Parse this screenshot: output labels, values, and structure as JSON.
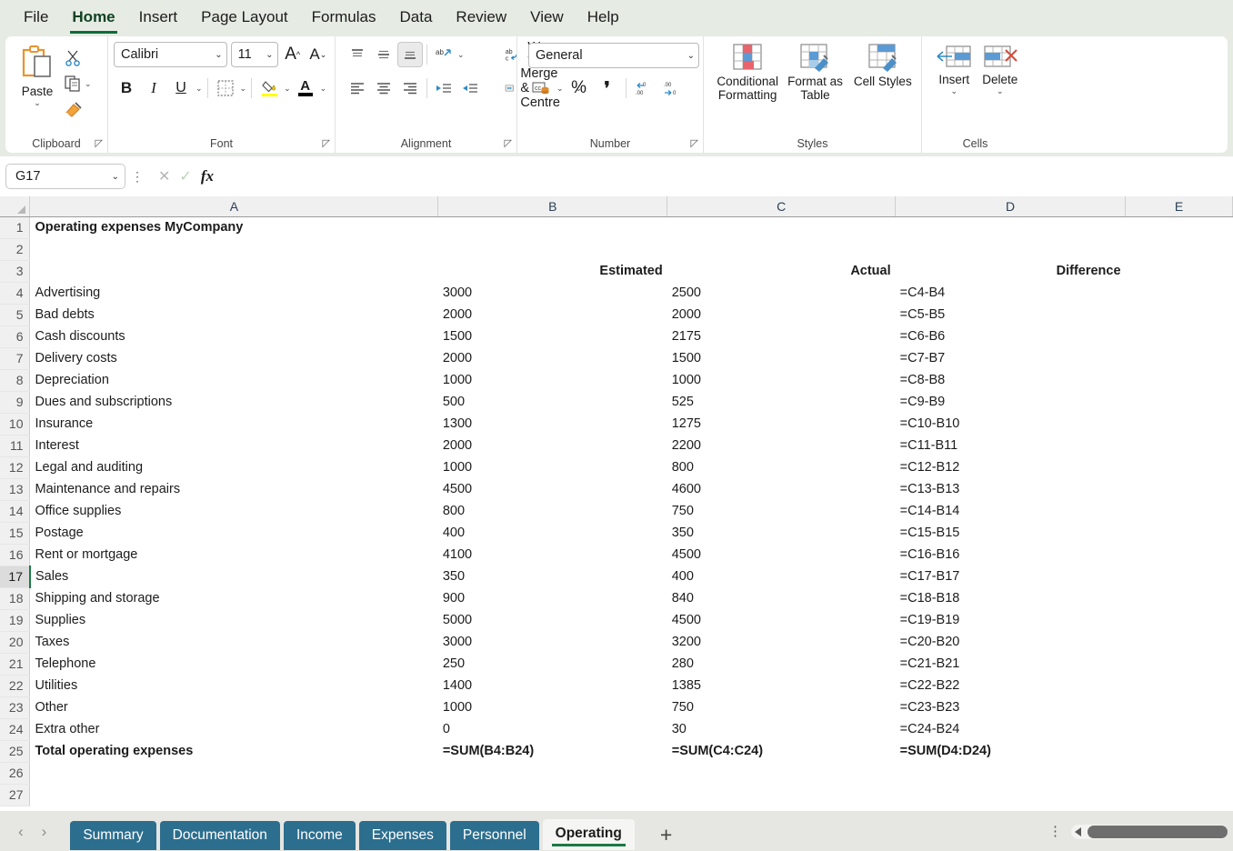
{
  "ribbon": {
    "tabs": [
      {
        "label": "File",
        "active": false
      },
      {
        "label": "Home",
        "active": true
      },
      {
        "label": "Insert",
        "active": false
      },
      {
        "label": "Page Layout",
        "active": false
      },
      {
        "label": "Formulas",
        "active": false
      },
      {
        "label": "Data",
        "active": false
      },
      {
        "label": "Review",
        "active": false
      },
      {
        "label": "View",
        "active": false
      },
      {
        "label": "Help",
        "active": false
      }
    ],
    "groups": {
      "clipboard": {
        "label": "Clipboard",
        "paste": "Paste",
        "cut_icon": "scissors-icon",
        "copy_icon": "copy-icon",
        "format_painter_icon": "format-painter-icon"
      },
      "font": {
        "label": "Font",
        "font_name": "Calibri",
        "font_size": "11",
        "grow_font": "A",
        "shrink_font": "A",
        "bold": "B",
        "italic": "I",
        "underline": "U"
      },
      "alignment": {
        "label": "Alignment",
        "wrap_text": "Wrap Text",
        "merge_centre": "Merge & Centre"
      },
      "number": {
        "label": "Number",
        "format": "General",
        "percent": "%",
        "comma": "‰"
      },
      "styles": {
        "label": "Styles",
        "conditional_formatting": "Conditional Formatting",
        "format_as_table": "Format as Table",
        "cell_styles": "Cell Styles"
      },
      "cells": {
        "label": "Cells",
        "insert": "Insert",
        "delete": "Delete"
      }
    }
  },
  "formula_bar": {
    "name_box": "G17",
    "formula_value": "",
    "cancel_icon": "close-icon",
    "enter_icon": "check-icon",
    "function_icon": "fx-icon"
  },
  "grid": {
    "columns": [
      "A",
      "B",
      "C",
      "D",
      "E"
    ],
    "selected_row": 17,
    "title": "Operating expenses MyCompany",
    "headers": {
      "a": "",
      "b": "Estimated",
      "c": "Actual",
      "d": "Difference"
    },
    "rows": [
      {
        "n": 4,
        "label": "Advertising",
        "estimated": "3000",
        "actual": "2500",
        "difference": "=C4-B4"
      },
      {
        "n": 5,
        "label": "Bad debts",
        "estimated": "2000",
        "actual": "2000",
        "difference": "=C5-B5"
      },
      {
        "n": 6,
        "label": "Cash discounts",
        "estimated": "1500",
        "actual": "2175",
        "difference": "=C6-B6"
      },
      {
        "n": 7,
        "label": "Delivery costs",
        "estimated": "2000",
        "actual": "1500",
        "difference": "=C7-B7"
      },
      {
        "n": 8,
        "label": "Depreciation",
        "estimated": "1000",
        "actual": "1000",
        "difference": "=C8-B8"
      },
      {
        "n": 9,
        "label": "Dues and subscriptions",
        "estimated": "500",
        "actual": "525",
        "difference": "=C9-B9"
      },
      {
        "n": 10,
        "label": "Insurance",
        "estimated": "1300",
        "actual": "1275",
        "difference": "=C10-B10"
      },
      {
        "n": 11,
        "label": "Interest",
        "estimated": "2000",
        "actual": "2200",
        "difference": "=C11-B11"
      },
      {
        "n": 12,
        "label": "Legal and auditing",
        "estimated": "1000",
        "actual": "800",
        "difference": "=C12-B12"
      },
      {
        "n": 13,
        "label": "Maintenance and repairs",
        "estimated": "4500",
        "actual": "4600",
        "difference": "=C13-B13"
      },
      {
        "n": 14,
        "label": "Office supplies",
        "estimated": "800",
        "actual": "750",
        "difference": "=C14-B14"
      },
      {
        "n": 15,
        "label": "Postage",
        "estimated": "400",
        "actual": "350",
        "difference": "=C15-B15"
      },
      {
        "n": 16,
        "label": "Rent or mortgage",
        "estimated": "4100",
        "actual": "4500",
        "difference": "=C16-B16"
      },
      {
        "n": 17,
        "label": "Sales",
        "estimated": "350",
        "actual": "400",
        "difference": "=C17-B17"
      },
      {
        "n": 18,
        "label": "Shipping and storage",
        "estimated": "900",
        "actual": "840",
        "difference": "=C18-B18"
      },
      {
        "n": 19,
        "label": "Supplies",
        "estimated": "5000",
        "actual": "4500",
        "difference": "=C19-B19"
      },
      {
        "n": 20,
        "label": "Taxes",
        "estimated": "3000",
        "actual": "3200",
        "difference": "=C20-B20"
      },
      {
        "n": 21,
        "label": "Telephone",
        "estimated": "250",
        "actual": "280",
        "difference": "=C21-B21"
      },
      {
        "n": 22,
        "label": "Utilities",
        "estimated": "1400",
        "actual": "1385",
        "difference": "=C22-B22"
      },
      {
        "n": 23,
        "label": "Other",
        "estimated": "1000",
        "actual": "750",
        "difference": "=C23-B23"
      },
      {
        "n": 24,
        "label": "Extra other",
        "estimated": "0",
        "actual": "30",
        "difference": "=C24-B24"
      }
    ],
    "total_row": {
      "n": 25,
      "label": "Total operating expenses",
      "estimated": "=SUM(B4:B24)",
      "actual": "=SUM(C4:C24)",
      "difference": "=SUM(D4:D24)"
    },
    "empty_rows": [
      26,
      27
    ]
  },
  "sheet_tabs": {
    "prev_icon": "chevron-left-icon",
    "next_icon": "chevron-right-icon",
    "tabs": [
      {
        "label": "Summary",
        "active": false
      },
      {
        "label": "Documentation",
        "active": false
      },
      {
        "label": "Income",
        "active": false
      },
      {
        "label": "Expenses",
        "active": false
      },
      {
        "label": "Personnel",
        "active": false
      },
      {
        "label": "Operating",
        "active": true
      }
    ],
    "add_label": "+"
  },
  "colors": {
    "accent_green": "#1a7a43",
    "tab_blue": "#2c6e8e",
    "title_blue": "#1f4e79",
    "header_fill": "#dbe9f4",
    "total_fill": "#ffff00",
    "table_border": "#44708d"
  }
}
